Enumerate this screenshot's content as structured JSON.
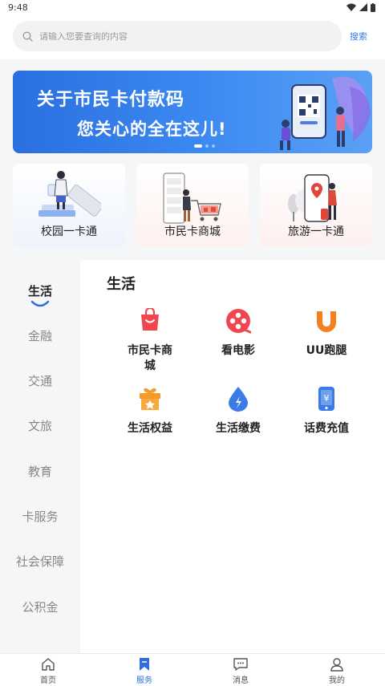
{
  "status_bar": {
    "time": "9:48"
  },
  "search": {
    "placeholder": "请输入您要查询的内容",
    "action_label": "搜索"
  },
  "banner": {
    "line1": "关于市民卡付款码",
    "line2": "您关心的全在这儿!"
  },
  "shortcut_cards": [
    {
      "label": "校园一卡通",
      "icon": "student-card-illustration"
    },
    {
      "label": "市民卡商城",
      "icon": "shopping-cart-illustration"
    },
    {
      "label": "旅游一卡通",
      "icon": "travel-map-illustration"
    }
  ],
  "sidebar": {
    "items": [
      {
        "label": "生活"
      },
      {
        "label": "金融"
      },
      {
        "label": "交通"
      },
      {
        "label": "文旅"
      },
      {
        "label": "教育"
      },
      {
        "label": "卡服务"
      },
      {
        "label": "社会保障"
      },
      {
        "label": "公积金"
      }
    ],
    "active_index": 0
  },
  "main": {
    "section_title": "生活",
    "items": [
      {
        "label": "市民卡商城",
        "icon": "shopping-bag-icon",
        "color": "#f0474f"
      },
      {
        "label": "看电影",
        "icon": "film-reel-icon",
        "color": "#f0474f"
      },
      {
        "label": "UU跑腿",
        "icon": "uu-logo-icon",
        "color": "#f57f1e"
      },
      {
        "label": "生活权益",
        "icon": "gift-box-icon",
        "color": "#f59a2a"
      },
      {
        "label": "生活缴费",
        "icon": "water-drop-icon",
        "color": "#3a7be8"
      },
      {
        "label": "话费充值",
        "icon": "phone-yuan-icon",
        "color": "#3a7be8"
      }
    ]
  },
  "tabbar": {
    "items": [
      {
        "label": "首页",
        "icon": "home-icon"
      },
      {
        "label": "服务",
        "icon": "bookmark-icon"
      },
      {
        "label": "消息",
        "icon": "message-icon"
      },
      {
        "label": "我的",
        "icon": "user-icon"
      }
    ],
    "active_index": 1
  },
  "colors": {
    "accent": "#2d6fe0",
    "banner_blue": "#2a6fe0",
    "sidebar_bg": "#f5f6f8"
  }
}
